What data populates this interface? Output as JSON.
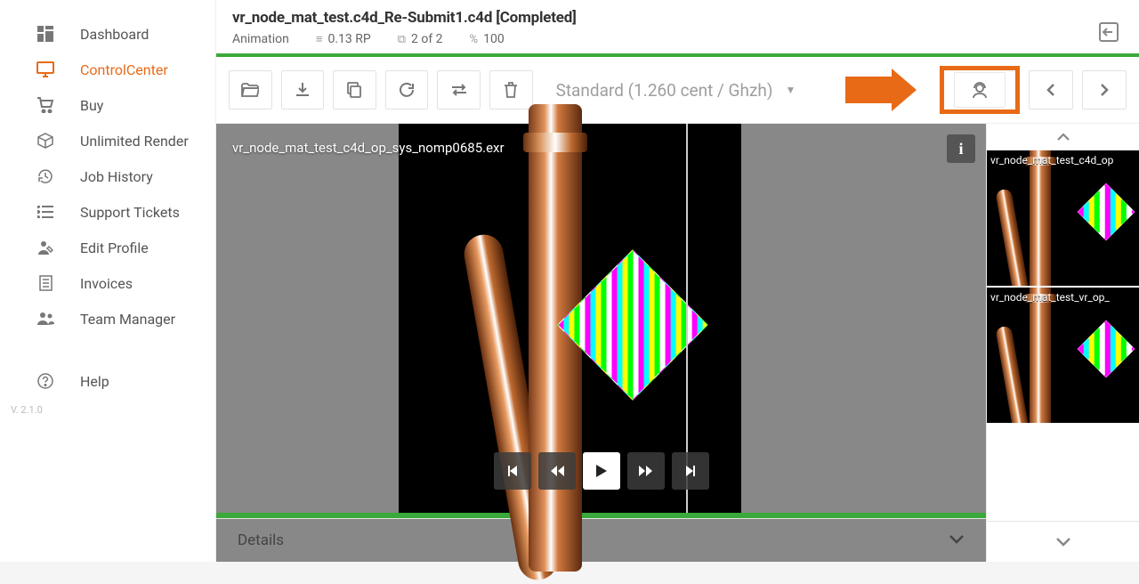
{
  "sidebar": {
    "items": [
      {
        "label": "Dashboard",
        "icon": "dashboard"
      },
      {
        "label": "ControlCenter",
        "icon": "monitor"
      },
      {
        "label": "Buy",
        "icon": "cart"
      },
      {
        "label": "Unlimited Render",
        "icon": "box"
      },
      {
        "label": "Job History",
        "icon": "history"
      },
      {
        "label": "Support Tickets",
        "icon": "list"
      },
      {
        "label": "Edit Profile",
        "icon": "user-edit"
      },
      {
        "label": "Invoices",
        "icon": "file"
      },
      {
        "label": "Team Manager",
        "icon": "team"
      }
    ],
    "help": "Help"
  },
  "version": "V. 2.1.0",
  "header": {
    "title": "vr_node_mat_test.c4d_Re-Submit1.c4d [Completed]",
    "type": "Animation",
    "rp": "0.13 RP",
    "frames": "2 of 2",
    "percent": "100"
  },
  "toolbar": {
    "cost_select": "Standard (1.260 cent / Ghzh)"
  },
  "preview": {
    "filename": "vr_node_mat_test_c4d_op_sys_nomp0685.exr"
  },
  "details": {
    "label": "Details"
  },
  "thumbs": [
    {
      "label": "vr_node_mat_test_c4d_op"
    },
    {
      "label": "vr_node_mat_test_vr_op_"
    }
  ]
}
